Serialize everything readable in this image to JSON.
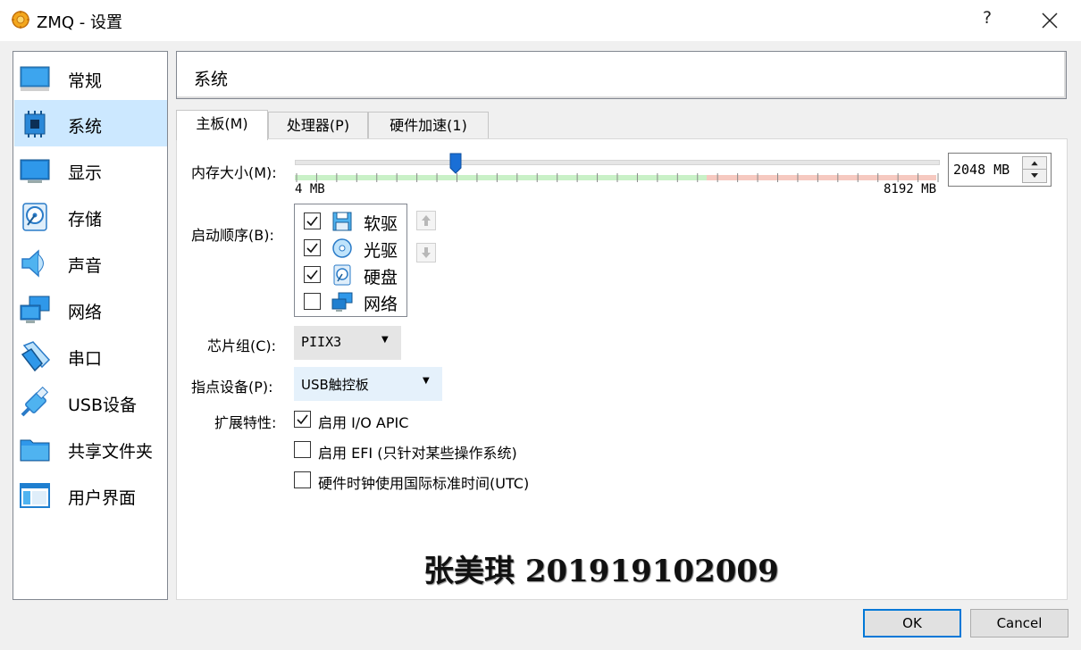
{
  "window": {
    "title": "ZMQ - 设置",
    "help": "?"
  },
  "sidebar": {
    "items": [
      {
        "label": "常规",
        "icon": "general-icon"
      },
      {
        "label": "系统",
        "icon": "system-chip-icon"
      },
      {
        "label": "显示",
        "icon": "display-monitor-icon"
      },
      {
        "label": "存储",
        "icon": "storage-disk-icon"
      },
      {
        "label": "声音",
        "icon": "audio-speaker-icon"
      },
      {
        "label": "网络",
        "icon": "network-icon"
      },
      {
        "label": "串口",
        "icon": "serial-port-icon"
      },
      {
        "label": "USB设备",
        "icon": "usb-icon"
      },
      {
        "label": "共享文件夹",
        "icon": "shared-folder-icon"
      },
      {
        "label": "用户界面",
        "icon": "user-interface-icon"
      }
    ],
    "selected": "系统"
  },
  "header": {
    "title": "系统"
  },
  "tabs": [
    {
      "label": "主板(M)",
      "active": true
    },
    {
      "label": "处理器(P)",
      "active": false
    },
    {
      "label": "硬件加速(1)",
      "active": false
    }
  ],
  "motherboard": {
    "memory": {
      "label": "内存大小(M):",
      "value": "2048 MB",
      "min_label": "4 MB",
      "max_label": "8192 MB",
      "value_mb": 2048,
      "min_mb": 4,
      "max_mb": 8192
    },
    "boot_order": {
      "label": "启动顺序(B):",
      "items": [
        {
          "label": "软驱",
          "checked": true,
          "icon": "floppy-icon"
        },
        {
          "label": "光驱",
          "checked": true,
          "icon": "optical-disc-icon"
        },
        {
          "label": "硬盘",
          "checked": true,
          "icon": "hard-disk-icon"
        },
        {
          "label": "网络",
          "checked": false,
          "icon": "network-icon"
        }
      ]
    },
    "chipset": {
      "label": "芯片组(C):",
      "value": "PIIX3"
    },
    "pointing_device": {
      "label": "指点设备(P):",
      "value": "USB触控板"
    },
    "extended": {
      "label": "扩展特性:",
      "options": [
        {
          "label": "启用 I/O APIC",
          "checked": true
        },
        {
          "label": "启用 EFI (只针对某些操作系统)",
          "checked": false
        },
        {
          "label": "硬件时钟使用国际标准时间(UTC)",
          "checked": false
        }
      ]
    }
  },
  "watermark": "张美琪 201919102009",
  "buttons": {
    "ok": "OK",
    "cancel": "Cancel"
  },
  "colors": {
    "selection": "#cce8ff",
    "accent": "#0078d7",
    "slider_handle": "#1a6fd6"
  }
}
